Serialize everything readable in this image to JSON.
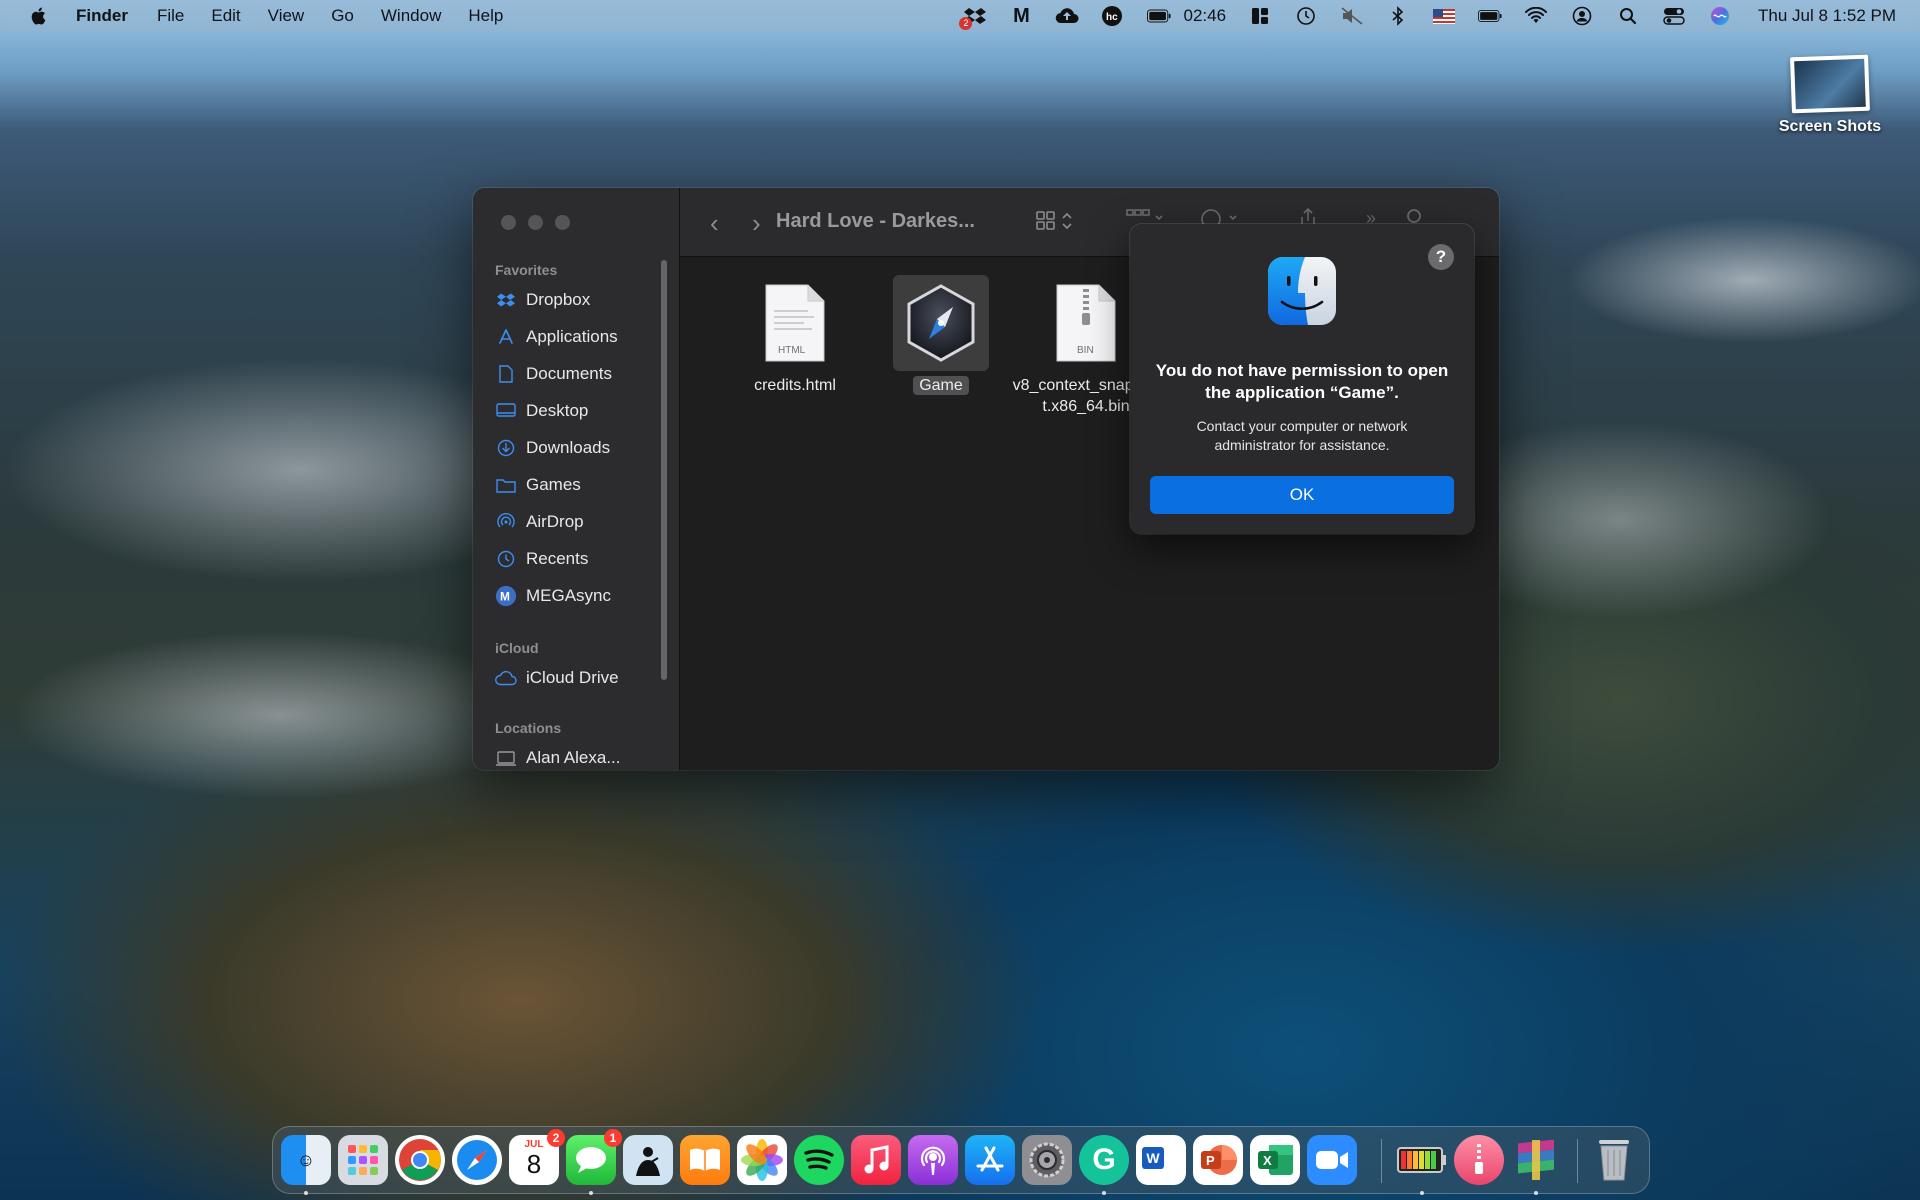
{
  "menubar": {
    "app_name": "Finder",
    "items": [
      "File",
      "Edit",
      "View",
      "Go",
      "Window",
      "Help"
    ],
    "battery_time": "02:46",
    "clock": "Thu Jul 8  1:52 PM",
    "dropbox_badge": "2"
  },
  "desktop": {
    "file_label": "Screen Shots"
  },
  "finder": {
    "title": "Hard Love - Darkes...",
    "sidebar": {
      "favorites_header": "Favorites",
      "favorites": [
        "Dropbox",
        "Applications",
        "Documents",
        "Desktop",
        "Downloads",
        "Games",
        "AirDrop",
        "Recents",
        "MEGAsync"
      ],
      "icloud_header": "iCloud",
      "icloud": [
        "iCloud Drive"
      ],
      "locations_header": "Locations",
      "locations": [
        "Alan Alexa..."
      ]
    },
    "files": [
      {
        "name": "credits.html",
        "type_label": "HTML"
      },
      {
        "name": "Game"
      },
      {
        "name": "v8_context_snapshot.x86_64.bin",
        "type_label": "BIN"
      }
    ]
  },
  "dialog": {
    "help": "?",
    "title": "You do not have permission to open the application “Game”.",
    "message": "Contact your computer or network administrator for assistance.",
    "ok": "OK"
  },
  "dock": {
    "calendar_month": "JUL",
    "calendar_day": "8",
    "calendar_badge": "2",
    "messages_badge": "1"
  }
}
